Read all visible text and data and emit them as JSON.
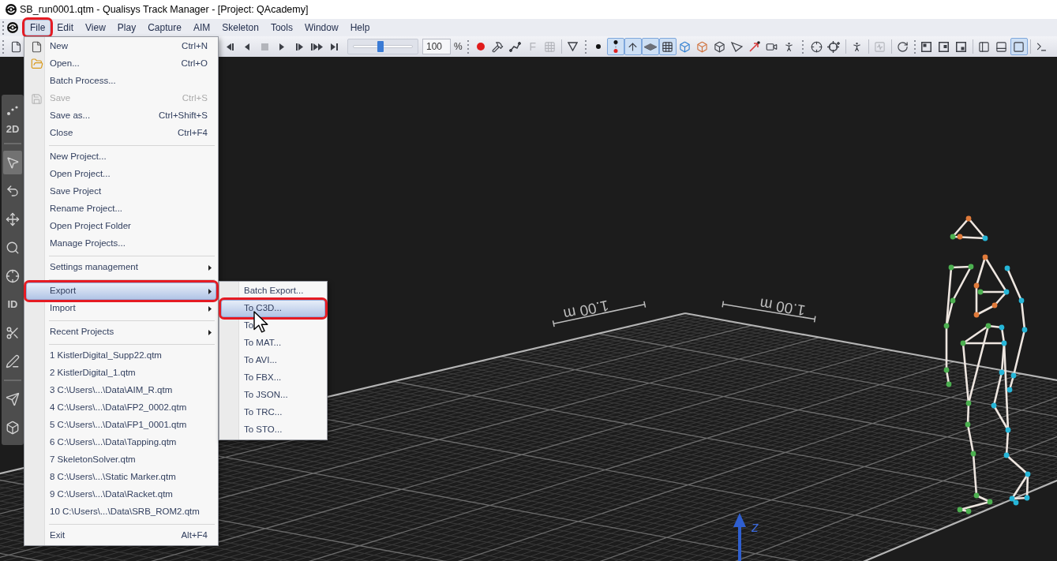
{
  "window": {
    "title": "SB_run0001.qtm - Qualisys Track Manager - [Project: QAcademy]"
  },
  "menu_bar": [
    {
      "label": "File",
      "selected": true
    },
    {
      "label": "Edit",
      "selected": false
    },
    {
      "label": "View",
      "selected": false
    },
    {
      "label": "Play",
      "selected": false
    },
    {
      "label": "Capture",
      "selected": false
    },
    {
      "label": "AIM",
      "selected": false
    },
    {
      "label": "Skeleton",
      "selected": false
    },
    {
      "label": "Tools",
      "selected": false
    },
    {
      "label": "Window",
      "selected": false
    },
    {
      "label": "Help",
      "selected": false
    }
  ],
  "toolbar": {
    "playback": [
      {
        "disabled": false
      },
      {
        "disabled": false
      },
      {
        "disabled": true
      },
      {
        "disabled": false
      },
      {
        "disabled": false
      },
      {
        "disabled": false
      },
      {
        "disabled": false
      }
    ],
    "speed": {
      "level": 0.45,
      "value": "100",
      "unit": "%"
    },
    "tools": [
      {
        "kind": "icon",
        "disabled": false
      },
      {
        "kind": "icon",
        "disabled": false
      },
      {
        "kind": "icon",
        "disabled": false
      },
      {
        "kind": "glyph",
        "text": "F",
        "disabled": true
      },
      {
        "kind": "icon",
        "disabled": true
      }
    ],
    "display": [
      {
        "on": false
      },
      {
        "on": true
      },
      {
        "on": true
      },
      {
        "on": true
      },
      {
        "on": true
      }
    ],
    "analysis": {
      "disabled": true
    },
    "layout": [
      {
        "on": false
      },
      {
        "on": false
      },
      {
        "on": false
      },
      {
        "on": false
      },
      {
        "on": false
      },
      {
        "on": true
      }
    ]
  },
  "left_toolbar": [
    {
      "kind": "icon",
      "selected": false
    },
    {
      "kind": "text",
      "text": "2D",
      "selected": false
    },
    {
      "kind": "separator"
    },
    {
      "kind": "icon",
      "selected": true
    },
    {
      "kind": "icon",
      "selected": false
    },
    {
      "kind": "icon",
      "selected": false
    },
    {
      "kind": "icon",
      "selected": false
    },
    {
      "kind": "icon",
      "selected": false
    },
    {
      "kind": "text",
      "text": "ID",
      "selected": false
    },
    {
      "kind": "icon",
      "selected": false
    },
    {
      "kind": "icon",
      "selected": false
    },
    {
      "kind": "separator"
    },
    {
      "kind": "icon",
      "selected": false
    },
    {
      "kind": "icon",
      "selected": false
    }
  ],
  "viewport": {
    "scale_labels": [
      "1.00 m",
      "1.00 m"
    ],
    "axis_label": "z"
  },
  "file_menu": [
    {
      "kind": "item",
      "label": "New",
      "shortcut": "Ctrl+N",
      "disabled": false,
      "selected": false
    },
    {
      "kind": "item",
      "label": "Open...",
      "shortcut": "Ctrl+O",
      "disabled": false,
      "selected": false
    },
    {
      "kind": "item",
      "label": "Batch Process...",
      "disabled": false,
      "selected": false
    },
    {
      "kind": "item",
      "label": "Save",
      "shortcut": "Ctrl+S",
      "disabled": true,
      "selected": false
    },
    {
      "kind": "item",
      "label": "Save as...",
      "shortcut": "Ctrl+Shift+S",
      "disabled": false,
      "selected": false
    },
    {
      "kind": "item",
      "label": "Close",
      "shortcut": "Ctrl+F4",
      "disabled": false,
      "selected": false
    },
    {
      "kind": "separator"
    },
    {
      "kind": "item",
      "label": "New Project...",
      "disabled": false,
      "selected": false
    },
    {
      "kind": "item",
      "label": "Open Project...",
      "disabled": false,
      "selected": false
    },
    {
      "kind": "item",
      "label": "Save Project",
      "disabled": false,
      "selected": false
    },
    {
      "kind": "item",
      "label": "Rename Project...",
      "disabled": false,
      "selected": false
    },
    {
      "kind": "item",
      "label": "Open Project Folder",
      "disabled": false,
      "selected": false
    },
    {
      "kind": "item",
      "label": "Manage Projects...",
      "disabled": false,
      "selected": false
    },
    {
      "kind": "separator"
    },
    {
      "kind": "submenu",
      "label": "Settings management",
      "disabled": false,
      "selected": false
    },
    {
      "kind": "separator"
    },
    {
      "kind": "submenu",
      "label": "Export",
      "disabled": false,
      "selected": true,
      "items": [
        {
          "label": "Batch Export...",
          "disabled": false,
          "selected": false
        },
        {
          "label": "To C3D...",
          "disabled": false,
          "selected": true
        },
        {
          "label": "To",
          "disabled": false,
          "selected": false
        },
        {
          "label": "To MAT...",
          "disabled": false,
          "selected": false
        },
        {
          "label": "To AVI...",
          "disabled": false,
          "selected": false
        },
        {
          "label": "To FBX...",
          "disabled": false,
          "selected": false
        },
        {
          "label": "To JSON...",
          "disabled": false,
          "selected": false
        },
        {
          "label": "To TRC...",
          "disabled": false,
          "selected": false
        },
        {
          "label": "To STO...",
          "disabled": false,
          "selected": false
        }
      ]
    },
    {
      "kind": "submenu",
      "label": "Import",
      "disabled": false,
      "selected": false
    },
    {
      "kind": "separator"
    },
    {
      "kind": "submenu",
      "label": "Recent Projects",
      "disabled": false,
      "selected": false
    },
    {
      "kind": "separator"
    },
    {
      "kind": "item",
      "label": "1 KistlerDigital_Supp22.qtm",
      "disabled": false,
      "selected": false
    },
    {
      "kind": "item",
      "label": "2 KistlerDigital_1.qtm",
      "disabled": false,
      "selected": false
    },
    {
      "kind": "item",
      "label": "3 C:\\Users\\...\\Data\\AIM_R.qtm",
      "disabled": false,
      "selected": false
    },
    {
      "kind": "item",
      "label": "4 C:\\Users\\...\\Data\\FP2_0002.qtm",
      "disabled": false,
      "selected": false
    },
    {
      "kind": "item",
      "label": "5 C:\\Users\\...\\Data\\FP1_0001.qtm",
      "disabled": false,
      "selected": false
    },
    {
      "kind": "item",
      "label": "6 C:\\Users\\...\\Data\\Tapping.qtm",
      "disabled": false,
      "selected": false
    },
    {
      "kind": "item",
      "label": "7 SkeletonSolver.qtm",
      "disabled": false,
      "selected": false
    },
    {
      "kind": "item",
      "label": "8 C:\\Users\\...\\Static Marker.qtm",
      "disabled": false,
      "selected": false
    },
    {
      "kind": "item",
      "label": "9 C:\\Users\\...\\Data\\Racket.qtm",
      "disabled": false,
      "selected": false
    },
    {
      "kind": "item",
      "label": "10 C:\\Users\\...\\Data\\SRB_ROM2.qtm",
      "disabled": false,
      "selected": false
    },
    {
      "kind": "separator"
    },
    {
      "kind": "item",
      "label": "Exit",
      "shortcut": "Alt+F4",
      "disabled": false,
      "selected": false
    }
  ]
}
